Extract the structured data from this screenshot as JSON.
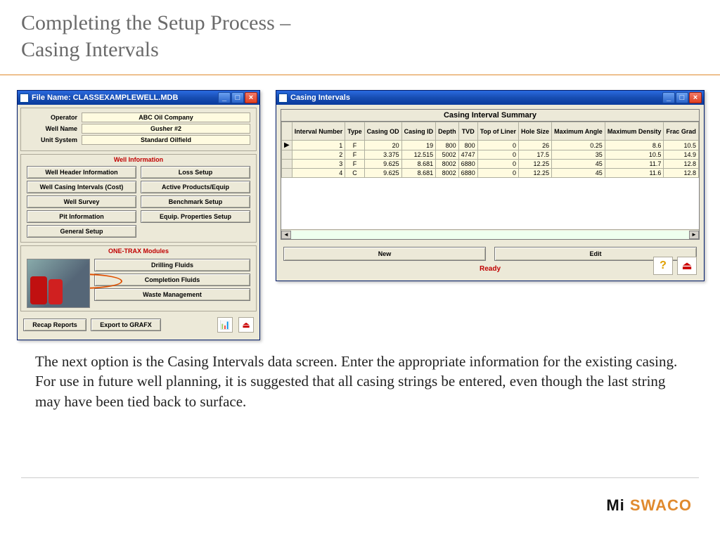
{
  "slide": {
    "title_line1": "Completing the Setup Process –",
    "title_line2": "Casing Intervals",
    "body_text": "The next option is the Casing Intervals data screen.  Enter the appropriate  information for the existing casing.  For  use in future well planning, it is suggested that all casing strings be entered, even though the last string may have been tied back to surface.",
    "logo_mi": "Mi",
    "logo_sw": " SWACO"
  },
  "left_window": {
    "title": "File Name: CLASSEXAMPLEWELL.MDB",
    "info": {
      "operator_label": "Operator",
      "operator_value": "ABC Oil Company",
      "wellname_label": "Well Name",
      "wellname_value": "Gusher #2",
      "unitsystem_label": "Unit System",
      "unitsystem_value": "Standard Oilfield"
    },
    "section_wellinfo": "Well Information",
    "buttons": {
      "well_header": "Well Header Information",
      "loss_setup": "Loss Setup",
      "casing_intervals": "Well Casing Intervals (Cost)",
      "active_products": "Active Products/Equip",
      "well_survey": "Well Survey",
      "benchmark": "Benchmark Setup",
      "pit_info": "Pit Information",
      "equip_props": "Equip. Properties Setup",
      "general_setup": "General Setup"
    },
    "section_modules": "ONE-TRAX Modules",
    "module_buttons": {
      "drilling": "Drilling Fluids",
      "completion": "Completion Fluids",
      "waste": "Waste Management"
    },
    "bottom": {
      "recap": "Recap Reports",
      "export": "Export to GRAFX"
    }
  },
  "right_window": {
    "title": "Casing Intervals",
    "grid_title": "Casing Interval Summary",
    "columns": [
      "Interval Number",
      "Type",
      "Casing OD",
      "Casing ID",
      "Depth",
      "TVD",
      "Top of Liner",
      "Hole Size",
      "Maximum Angle",
      "Maximum Density",
      "Frac Grad"
    ],
    "rows": [
      {
        "n": "1",
        "type": "F",
        "od": "20",
        "id": "19",
        "depth": "800",
        "tvd": "800",
        "top": "0",
        "hole": "26",
        "ang": "0.25",
        "dens": "8.6",
        "frac": "10.5"
      },
      {
        "n": "2",
        "type": "F",
        "od": "3.375",
        "id": "12.515",
        "depth": "5002",
        "tvd": "4747",
        "top": "0",
        "hole": "17.5",
        "ang": "35",
        "dens": "10.5",
        "frac": "14.9"
      },
      {
        "n": "3",
        "type": "F",
        "od": "9.625",
        "id": "8.681",
        "depth": "8002",
        "tvd": "6880",
        "top": "0",
        "hole": "12.25",
        "ang": "45",
        "dens": "11.7",
        "frac": "12.8"
      },
      {
        "n": "4",
        "type": "C",
        "od": "9.625",
        "id": "8.681",
        "depth": "8002",
        "tvd": "6880",
        "top": "0",
        "hole": "12.25",
        "ang": "45",
        "dens": "11.6",
        "frac": "12.8"
      }
    ],
    "new_btn": "New",
    "edit_btn": "Edit",
    "status": "Ready"
  }
}
